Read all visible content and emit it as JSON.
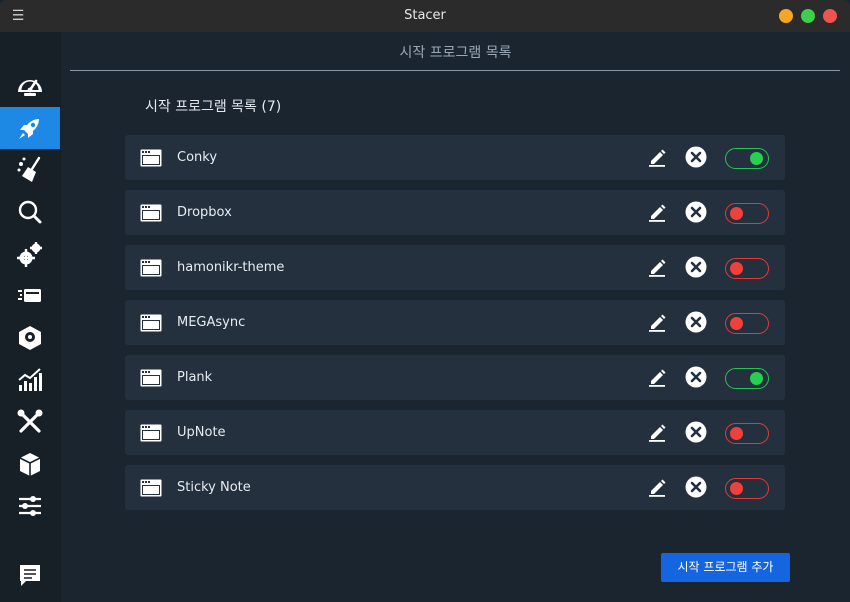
{
  "window": {
    "title": "Stacer",
    "menu_glyph": "☰"
  },
  "sidebar": {
    "items": [
      {
        "icon": "dashboard-icon",
        "active": false
      },
      {
        "icon": "rocket-icon",
        "active": true
      },
      {
        "icon": "broom-icon",
        "active": false
      },
      {
        "icon": "search-icon",
        "active": false
      },
      {
        "icon": "gears-icon",
        "active": false
      },
      {
        "icon": "processes-icon",
        "active": false
      },
      {
        "icon": "uninstaller-icon",
        "active": false
      },
      {
        "icon": "resources-icon",
        "active": false
      },
      {
        "icon": "tools-icon",
        "active": false
      },
      {
        "icon": "package-icon",
        "active": false
      },
      {
        "icon": "settings-sliders-icon",
        "active": false
      }
    ],
    "feedback_icon": "feedback-icon"
  },
  "header": {
    "title": "시작 프로그램 목록"
  },
  "startup": {
    "section_title": "시작 프로그램 목록 (7)",
    "apps": [
      {
        "name": "Conky",
        "enabled": true
      },
      {
        "name": "Dropbox",
        "enabled": false
      },
      {
        "name": "hamonikr-theme",
        "enabled": false
      },
      {
        "name": "MEGAsync",
        "enabled": false
      },
      {
        "name": "Plank",
        "enabled": true
      },
      {
        "name": "UpNote",
        "enabled": false
      },
      {
        "name": "Sticky Note",
        "enabled": false
      }
    ],
    "add_button": "시작 프로그램 추가"
  },
  "colors": {
    "accent": "#1e88e5",
    "toggle_on": "#27d04f",
    "toggle_off": "#f0403c",
    "button": "#1565e0"
  }
}
